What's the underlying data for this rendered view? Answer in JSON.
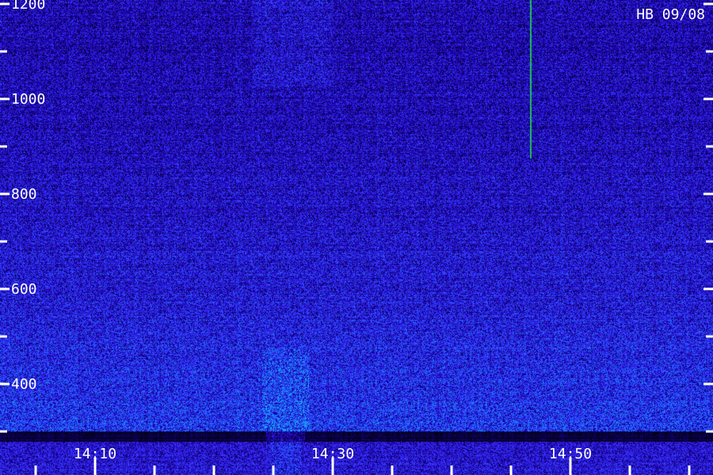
{
  "chart_data": {
    "type": "heatmap",
    "title": "",
    "corner_label": "HB 09/08",
    "xlabel": "",
    "ylabel": "",
    "y_tick_labels": [
      "1200",
      "1000",
      "800",
      "600",
      "400"
    ],
    "y_tick_values": [
      1200,
      1000,
      800,
      600,
      400
    ],
    "y_minor_tick_values": [
      1100,
      900,
      700,
      500,
      300
    ],
    "ylim": [
      300,
      1200
    ],
    "x_tick_labels": [
      "14:10",
      "14:30",
      "14:50"
    ],
    "x_tick_values_min": [
      10,
      30,
      50
    ],
    "x_minor_tick_values_min": [
      5,
      15,
      20,
      25,
      35,
      40,
      45,
      55,
      60
    ],
    "xlim_min": [
      2,
      62
    ],
    "colormap": [
      "#000000",
      "#1a00b4",
      "#3a2bff",
      "#1f6bff",
      "#14c8ff"
    ],
    "grid": false,
    "legend": "none",
    "features": [
      {
        "kind": "vertical-line",
        "time_min": 46.6,
        "color": "#20c060"
      },
      {
        "kind": "broadband-burst",
        "time_min": 26,
        "freq_range": [
          300,
          400
        ]
      }
    ]
  }
}
